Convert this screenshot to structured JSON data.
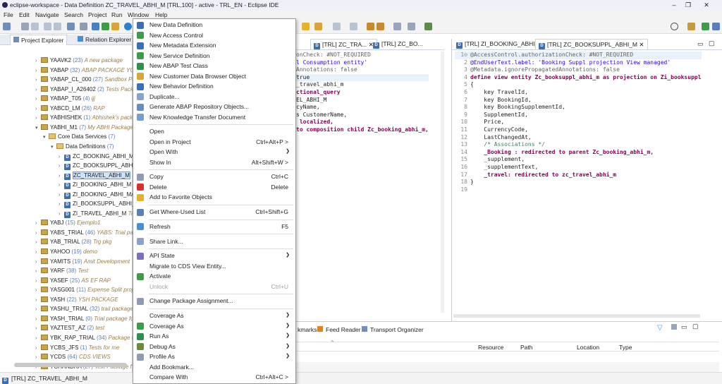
{
  "window": {
    "title": "eclipse-workspace - Data Definition ZC_TRAVEL_ABHI_M [TRL,100] - active - TRL_EN - Eclipse IDE",
    "minimize": "–",
    "restore": "❐",
    "close": "✕"
  },
  "menu": [
    "File",
    "Edit",
    "Navigate",
    "Search",
    "Project",
    "Run",
    "Window",
    "Help"
  ],
  "left_tabs": {
    "project_explorer": "Project Explorer",
    "relation_explorer": "Relation Explorer"
  },
  "tree": [
    {
      "indent": 0,
      "kind": "pkg",
      "name": "YAAVK2",
      "count": "(23)",
      "desc": "A new package"
    },
    {
      "indent": 0,
      "kind": "pkg",
      "name": "YABAP",
      "count": "(32)",
      "desc": "ABAP PACKAGE YO"
    },
    {
      "indent": 0,
      "kind": "pkg",
      "name": "YABAP_CL_000",
      "count": "(27)",
      "desc": "Sandbox Pa"
    },
    {
      "indent": 0,
      "kind": "pkg",
      "name": "YABAP_I_A26402",
      "count": "(2)",
      "desc": "Tests Pack"
    },
    {
      "indent": 0,
      "kind": "pkg",
      "name": "YABAP_T05",
      "count": "(4)",
      "desc": "ijj"
    },
    {
      "indent": 0,
      "kind": "pkg",
      "name": "YABCD_LM",
      "count": "(26)",
      "desc": "RAP"
    },
    {
      "indent": 0,
      "kind": "pkg",
      "name": "YABHISHEK",
      "count": "(1)",
      "desc": "Abhishek's pack"
    },
    {
      "indent": 0,
      "kind": "pkg",
      "open": true,
      "name": "YABHI_M1",
      "count": "(7)",
      "desc": "My ABHI Package"
    },
    {
      "indent": 1,
      "kind": "fld",
      "open": true,
      "name": "Core Data Services",
      "count": "(7)",
      "desc": ""
    },
    {
      "indent": 2,
      "kind": "fld",
      "open": true,
      "name": "Data Definitions",
      "count": "(7)",
      "desc": ""
    },
    {
      "indent": 3,
      "kind": "ddl",
      "name": "ZC_BOOKING_ABHI_M",
      "count": "",
      "desc": ""
    },
    {
      "indent": 3,
      "kind": "ddl",
      "name": "ZC_BOOKSUPPL_ABHI_",
      "count": "",
      "desc": ""
    },
    {
      "indent": 3,
      "kind": "ddl",
      "sel": true,
      "name": "ZC_TRAVEL_ABHI_M",
      "count": "",
      "desc": "T"
    },
    {
      "indent": 3,
      "kind": "ddl",
      "name": "ZI_BOOKING_ABHI_M",
      "count": "",
      "desc": ""
    },
    {
      "indent": 3,
      "kind": "ddl",
      "name": "ZI_BOOKING_ABHI_MA",
      "count": "",
      "desc": ""
    },
    {
      "indent": 3,
      "kind": "ddl",
      "name": "ZI_BOOKSUPPL_ABHI_M",
      "count": "",
      "desc": ""
    },
    {
      "indent": 3,
      "kind": "ddl",
      "name": "ZI_TRAVEL_ABHI_M",
      "count": "",
      "desc": "Tr"
    },
    {
      "indent": 0,
      "kind": "pkg",
      "name": "YABJ",
      "count": "(15)",
      "desc": "Ejemplo1"
    },
    {
      "indent": 0,
      "kind": "pkg",
      "name": "YABS_TRIAL",
      "count": "(46)",
      "desc": "YABS: Trial pac"
    },
    {
      "indent": 0,
      "kind": "pkg",
      "name": "YAB_TRIAL",
      "count": "(28)",
      "desc": "Trg pkg"
    },
    {
      "indent": 0,
      "kind": "pkg",
      "name": "YAHOO",
      "count": "(19)",
      "desc": "demo"
    },
    {
      "indent": 0,
      "kind": "pkg",
      "name": "YAMITS",
      "count": "(19)",
      "desc": "Amit Development"
    },
    {
      "indent": 0,
      "kind": "pkg",
      "name": "YARF",
      "count": "(38)",
      "desc": "Test"
    },
    {
      "indent": 0,
      "kind": "pkg",
      "name": "YASEF",
      "count": "(25)",
      "desc": "AS EF RAP"
    },
    {
      "indent": 0,
      "kind": "pkg",
      "name": "YASG001",
      "count": "(11)",
      "desc": "Expense Split proj"
    },
    {
      "indent": 0,
      "kind": "pkg",
      "name": "YASH",
      "count": "(22)",
      "desc": "YSH PACKAGE"
    },
    {
      "indent": 0,
      "kind": "pkg",
      "name": "YASHU_TRIAL",
      "count": "(32)",
      "desc": "trail package"
    },
    {
      "indent": 0,
      "kind": "pkg",
      "name": "YASH_TRIAL",
      "count": "(0)",
      "desc": "Trial package fo"
    },
    {
      "indent": 0,
      "kind": "pkg",
      "name": "YAZTEST_AZ",
      "count": "(2)",
      "desc": "test"
    },
    {
      "indent": 0,
      "kind": "pkg",
      "name": "YBK_RAP_TRIAL",
      "count": "(34)",
      "desc": "Package fo"
    },
    {
      "indent": 0,
      "kind": "pkg",
      "name": "YCBS_JFS",
      "count": "(1)",
      "desc": "Tests for me"
    },
    {
      "indent": 0,
      "kind": "pkg",
      "name": "YCDS",
      "count": "(64)",
      "desc": "CDS VIEWS"
    },
    {
      "indent": 0,
      "kind": "pkg",
      "name": "YCHANDRA",
      "count": "(27)",
      "desc": "Text Package f"
    }
  ],
  "context_menu": [
    {
      "label": "New Data Definition",
      "icon": "#3a6fb5",
      "shortcut": "",
      "sub": false
    },
    {
      "label": "New Access Control",
      "icon": "#3f9b4b",
      "shortcut": "",
      "sub": false
    },
    {
      "label": "New Metadata Extension",
      "icon": "#3a6fb5",
      "shortcut": "",
      "sub": false
    },
    {
      "label": "New Service Definition",
      "icon": "#3f9b4b",
      "shortcut": "",
      "sub": false
    },
    {
      "label": "New ABAP Test Class",
      "icon": "#2f8f4f",
      "shortcut": "",
      "sub": false
    },
    {
      "label": "New Customer Data Browser Object",
      "icon": "#d9a53a",
      "shortcut": "",
      "sub": false
    },
    {
      "label": "New Behavior Definition",
      "icon": "#3a6fb5",
      "shortcut": "",
      "sub": false
    },
    {
      "label": "Duplicate...",
      "icon": "#8aa2c8",
      "shortcut": "",
      "sub": false
    },
    {
      "label": "Generate ABAP Repository Objects...",
      "icon": "#6c8bbf",
      "shortcut": "",
      "sub": false
    },
    {
      "label": "New Knowledge Transfer Document",
      "icon": "#7a9ccc",
      "shortcut": "",
      "sub": false,
      "sepAfter": true
    },
    {
      "label": "Open",
      "icon": "",
      "shortcut": "",
      "sub": false
    },
    {
      "label": "Open in Project",
      "icon": "",
      "shortcut": "Ctrl+Alt+P >",
      "sub": false
    },
    {
      "label": "Open With",
      "icon": "",
      "shortcut": "",
      "sub": true
    },
    {
      "label": "Show In",
      "icon": "",
      "shortcut": "Alt+Shift+W >",
      "sub": false,
      "sepAfter": true
    },
    {
      "label": "Copy",
      "icon": "#8e9bb0",
      "shortcut": "Ctrl+C",
      "sub": false
    },
    {
      "label": "Delete",
      "icon": "#d2342c",
      "shortcut": "Delete",
      "sub": false
    },
    {
      "label": "Add to Favorite Objects",
      "icon": "#e3b22e",
      "shortcut": "",
      "sub": false,
      "sepAfter": true
    },
    {
      "label": "Get Where-Used List",
      "icon": "#5a7fb8",
      "shortcut": "Ctrl+Shift+G",
      "sub": false,
      "sepAfter": true
    },
    {
      "label": "Refresh",
      "icon": "#4a8fd0",
      "shortcut": "F5",
      "sub": false,
      "sepAfter": true
    },
    {
      "label": "Share Link...",
      "icon": "#8aa2c8",
      "shortcut": "",
      "sub": false,
      "sepAfter": true
    },
    {
      "label": "API State",
      "icon": "#7d6fb8",
      "shortcut": "",
      "sub": true
    },
    {
      "label": "Migrate to CDS View Entity...",
      "icon": "",
      "shortcut": "",
      "sub": false
    },
    {
      "label": "Activate",
      "icon": "#3f9b4b",
      "shortcut": "",
      "sub": false
    },
    {
      "label": "Unlock",
      "icon": "",
      "shortcut": "Ctrl+U",
      "sub": false,
      "disabled": true,
      "sepAfter": true
    },
    {
      "label": "Change Package Assignment...",
      "icon": "#8e9bb0",
      "shortcut": "",
      "sub": false,
      "sepAfter": true
    },
    {
      "label": "Coverage As",
      "icon": "",
      "shortcut": "",
      "sub": true
    },
    {
      "label": "Coverage As",
      "icon": "#3f9b4b",
      "shortcut": "",
      "sub": true
    },
    {
      "label": "Run As",
      "icon": "#2f8f4f",
      "shortcut": "",
      "sub": true
    },
    {
      "label": "Debug As",
      "icon": "#6c8b3f",
      "shortcut": "",
      "sub": true
    },
    {
      "label": "Profile As",
      "icon": "#8e9bb0",
      "shortcut": "",
      "sub": true
    },
    {
      "label": "Add Bookmark...",
      "icon": "",
      "shortcut": "",
      "sub": false
    },
    {
      "label": "Compare With",
      "icon": "",
      "shortcut": "Ctrl+Alt+C >",
      "sub": false
    }
  ],
  "editor1": {
    "tab1": "[TRL] ZC_TRA...",
    "tab2": "[TRL] ZC_BO...",
    "lines": [
      "onCheck: #NOT_REQUIRED",
      "l Consumption entity'",
      "Annotations: false",
      "true",
      "_travel_abhi_m",
      "ctional_query",
      "EL_ABHI_M",
      "",
      "",
      "",
      "cyName,",
      "",
      "s CustomerName,",
      "",
      "",
      "",
      "",
      "",
      "",
      " localized,",
      "",
      "",
      "",
      "",
      "",
      "",
      "to composition child Zc_booking_abhi_m,"
    ]
  },
  "editor2": {
    "tab1": "[TRL] ZI_BOOKING_ABHI_M",
    "tab2": "[TRL] ZC_BOOKSUPPL_ABHI_M",
    "lines": [
      [
        "1⊖",
        "@AccessControl.authorizationCheck: #NOT_REQUIRED"
      ],
      [
        "2",
        "@EndUserText.label: 'Booking Suppl projection View managed'"
      ],
      [
        "3",
        "@Metadata.ignorePropagatedAnnotations: false"
      ],
      [
        "4",
        "define view entity Zc_booksuppl_abhi_m as projection on Zi_booksuppl"
      ],
      [
        "5",
        "{"
      ],
      [
        "6",
        "    key TravelId,"
      ],
      [
        "7",
        "    key BookingId,"
      ],
      [
        "8",
        "    key BookingSupplementId,"
      ],
      [
        "9",
        "    SupplementId,"
      ],
      [
        "10",
        "    Price,"
      ],
      [
        "11",
        "    CurrencyCode,"
      ],
      [
        "12",
        "    LastChangedAt,"
      ],
      [
        "13",
        "    /* Associations */"
      ],
      [
        "14",
        "    _Booking : redirected to parent Zc_booking_abhi_m,"
      ],
      [
        "15",
        "    _supplement,"
      ],
      [
        "16",
        "    _supplementText,"
      ],
      [
        "17",
        "    _travel: redirected to zc_travel_abhi_m"
      ],
      [
        "18",
        "}"
      ],
      [
        "19",
        ""
      ]
    ]
  },
  "bottom": {
    "tabs": [
      "kmarks",
      "Feed Reader",
      "Transport Organizer"
    ],
    "columns": [
      "Resource",
      "Path",
      "Location",
      "Type"
    ]
  },
  "status": {
    "text": "[TRL] ZC_TRAVEL_ABHI_M"
  }
}
